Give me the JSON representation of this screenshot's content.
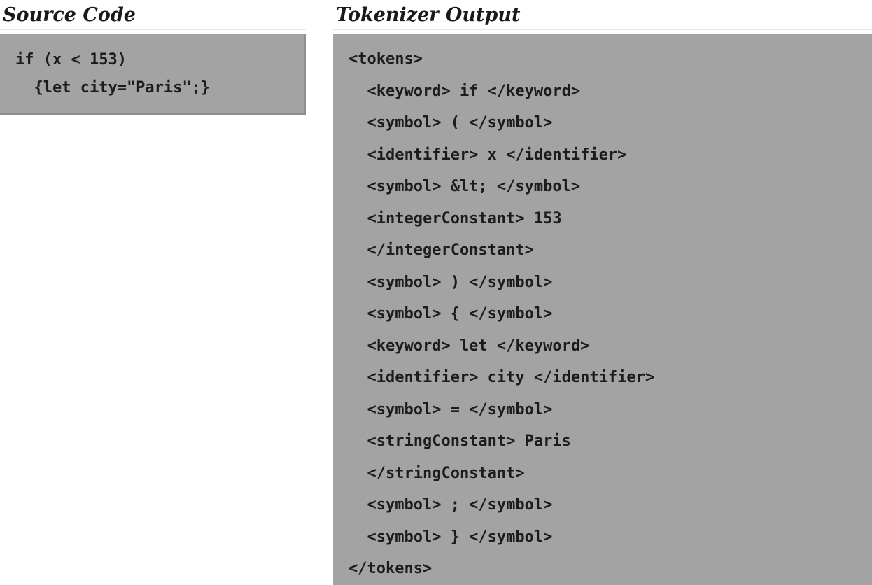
{
  "source_panel": {
    "title": "Source Code",
    "lines": [
      "if (x < 153)",
      "  {let city=\"Paris\";}"
    ]
  },
  "output_panel": {
    "title": "Tokenizer Output",
    "lines": [
      "<tokens>",
      "  <keyword> if </keyword>",
      "  <symbol> ( </symbol>",
      "  <identifier> x </identifier>",
      "  <symbol> &lt; </symbol>",
      "  <integerConstant> 153",
      "  </integerConstant>",
      "  <symbol> ) </symbol>",
      "  <symbol> { </symbol>",
      "  <keyword> let </keyword>",
      "  <identifier> city </identifier>",
      "  <symbol> = </symbol>",
      "  <stringConstant> Paris",
      "  </stringConstant>",
      "  <symbol> ; </symbol>",
      "  <symbol> } </symbol>",
      "</tokens>"
    ]
  },
  "colors": {
    "box_fill": "#a3a3a3",
    "text": "#1c1c1c"
  }
}
